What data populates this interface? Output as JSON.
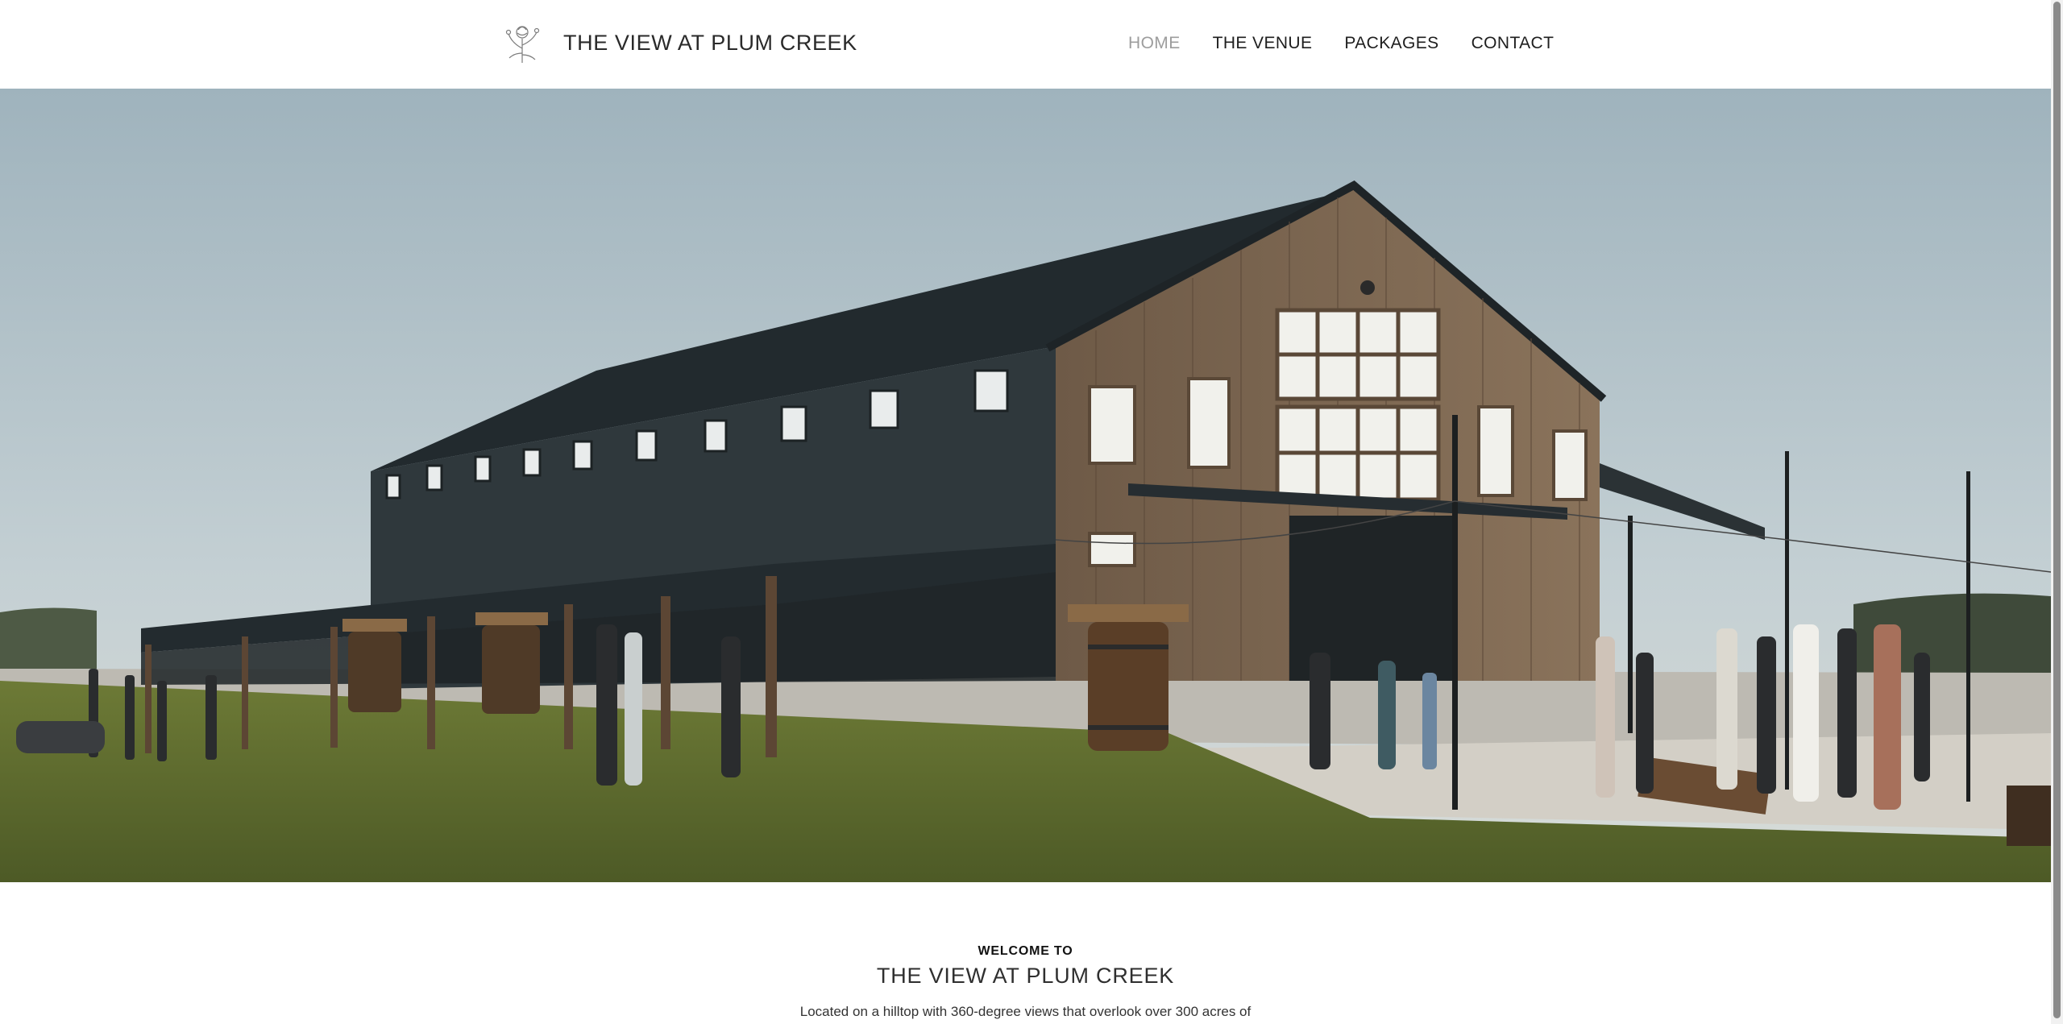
{
  "header": {
    "logo_icon": "flower-sprig-icon",
    "site_title": "THE VIEW AT PLUM CREEK"
  },
  "nav": {
    "items": [
      {
        "label": "HOME",
        "active": true
      },
      {
        "label": "THE VENUE",
        "active": false
      },
      {
        "label": "PACKAGES",
        "active": false
      },
      {
        "label": "CONTACT",
        "active": false
      }
    ]
  },
  "hero": {
    "image_subject": "barn-venue-photo"
  },
  "welcome": {
    "kicker": "WELCOME TO",
    "title": "THE VIEW AT PLUM CREEK",
    "text": "Located on a hilltop with 360-degree views that overlook over 300 acres of"
  },
  "colors": {
    "active_nav": "#9d9d9d",
    "text_dark": "#1e1e1e",
    "sky": "#b9c7cf",
    "grass": "#5d6a2c",
    "barn_wood": "#7a654f",
    "barn_roof": "#2b3338"
  }
}
